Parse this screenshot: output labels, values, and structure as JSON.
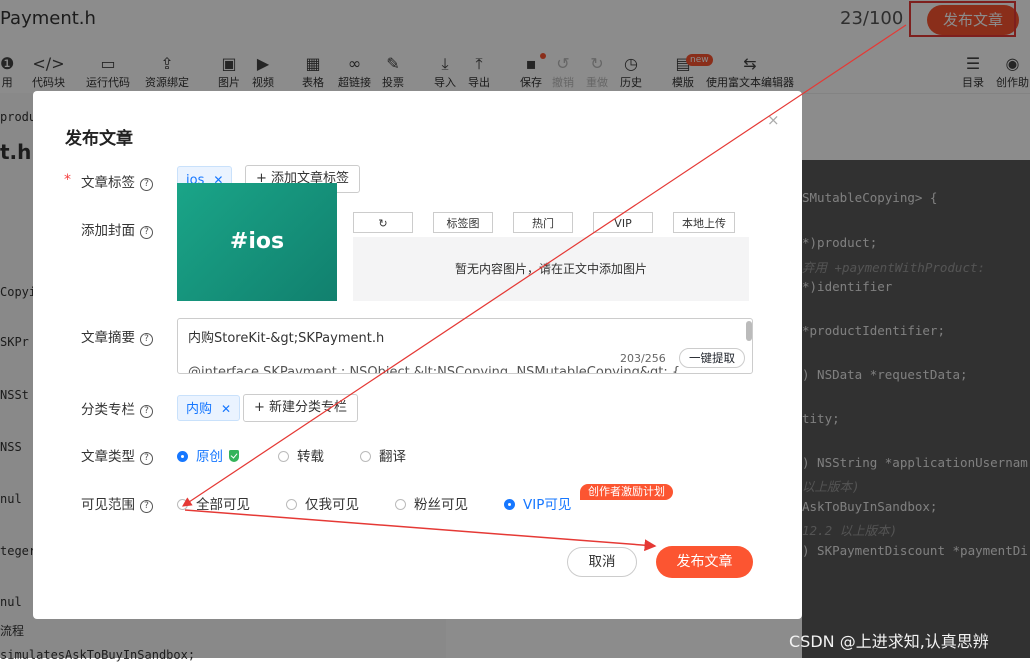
{
  "editor": {
    "title_value": "Payment.h",
    "word_count": "23/100",
    "publish_label": "发布文章",
    "heading_fragment": "t.h"
  },
  "toolbar": [
    {
      "icon": "bold-icon",
      "glyph": "❶",
      "label": "用",
      "dim": false
    },
    {
      "icon": "code-block-icon",
      "glyph": "</>",
      "label": "代码块",
      "dim": false
    },
    {
      "icon": "run-code-icon",
      "glyph": "▭",
      "label": "运行代码",
      "dim": false
    },
    {
      "icon": "resource-bind-icon",
      "glyph": "⇪",
      "label": "资源绑定",
      "dim": false
    },
    {
      "icon": "image-icon",
      "glyph": "▣",
      "label": "图片",
      "dim": false
    },
    {
      "icon": "video-icon",
      "glyph": "▶",
      "label": "视频",
      "dim": false
    },
    {
      "icon": "table-icon",
      "glyph": "▦",
      "label": "表格",
      "dim": false
    },
    {
      "icon": "link-icon",
      "glyph": "∞",
      "label": "超链接",
      "dim": false
    },
    {
      "icon": "vote-icon",
      "glyph": "✎",
      "label": "投票",
      "dim": false
    },
    {
      "icon": "import-icon",
      "glyph": "⤓",
      "label": "导入",
      "dim": false
    },
    {
      "icon": "export-icon",
      "glyph": "⤒",
      "label": "导出",
      "dim": false
    },
    {
      "icon": "save-icon",
      "glyph": "▪",
      "label": "保存",
      "dim": false
    },
    {
      "icon": "undo-icon",
      "glyph": "↺",
      "label": "撤销",
      "dim": true
    },
    {
      "icon": "redo-icon",
      "glyph": "↻",
      "label": "重做",
      "dim": true
    },
    {
      "icon": "history-icon",
      "glyph": "◷",
      "label": "历史",
      "dim": false
    },
    {
      "icon": "template-icon",
      "glyph": "▤",
      "label": "模版",
      "dim": false
    },
    {
      "icon": "rich-editor-icon",
      "glyph": "⇆",
      "label": "使用富文本编辑器",
      "dim": false
    },
    {
      "icon": "toc-icon",
      "glyph": "☰",
      "label": "目录",
      "dim": false
    },
    {
      "icon": "assistant-icon",
      "glyph": "◉",
      "label": "创作助",
      "dim": false
    }
  ],
  "new_badge": "new",
  "left_fragments": [
    "produ",
    "Copyi",
    "SKPr",
    "NSSt",
    "NSS",
    "nul",
    "teger",
    "nul",
    "流程",
    "simulatesAskToBuyInSandbox;"
  ],
  "code_lines": [
    {
      "text": "SMutableCopying> {",
      "comment": false
    },
    {
      "text": " *)product;",
      "comment": false
    },
    {
      "text": "弃用 +paymentWithProduct:",
      "comment": true
    },
    {
      "text": "*)identifier",
      "comment": false
    },
    {
      "text": " *productIdentifier;",
      "comment": false
    },
    {
      "text": ") NSData *requestData;",
      "comment": false
    },
    {
      "text": "tity;",
      "comment": false
    },
    {
      "text": ") NSString *applicationUsernam",
      "comment": false
    },
    {
      "text": "以上版本)",
      "comment": true
    },
    {
      "text": "AskToBuyInSandbox;",
      "comment": false
    },
    {
      "text": "12.2 以上版本)",
      "comment": true
    },
    {
      "text": ") SKPaymentDiscount *paymentDi",
      "comment": false
    }
  ],
  "watermark": "CSDN @上进求知,认真思辨",
  "modal": {
    "title": "发布文章",
    "close_glyph": "×",
    "labels": {
      "tags": "文章标签",
      "cover": "添加封面",
      "abstract": "文章摘要",
      "column": "分类专栏",
      "type": "文章类型",
      "visibility": "可见范围"
    },
    "tag": "ios",
    "add_tag": "添加文章标签",
    "cover_text": "#ios",
    "cover_tabs": [
      "↻",
      "标签图",
      "热门",
      "VIP",
      "本地上传"
    ],
    "cover_empty": "暂无内容图片，请在正文中添加图片",
    "abstract_line1": "内购StoreKit-&gt;SKPayment.h",
    "abstract_line2": "@interface SKPayment : NSObject &lt;NSCopying, NSMutableCopying&gt; {",
    "abstract_count": "203/256",
    "abstract_extract": "一键提取",
    "column_tag": "内购",
    "add_column": "新建分类专栏",
    "types": [
      {
        "label": "原创",
        "selected": true
      },
      {
        "label": "转载",
        "selected": false
      },
      {
        "label": "翻译",
        "selected": false
      }
    ],
    "visibility": [
      {
        "label": "全部可见",
        "selected": false
      },
      {
        "label": "仅我可见",
        "selected": false
      },
      {
        "label": "粉丝可见",
        "selected": false
      },
      {
        "label": "VIP可见",
        "selected": true
      }
    ],
    "incentive_badge": "创作者激励计划",
    "cancel": "取消",
    "publish": "发布文章"
  },
  "colors": {
    "accent": "#fc5531",
    "link": "#1677ff",
    "annotation": "#e53935"
  }
}
